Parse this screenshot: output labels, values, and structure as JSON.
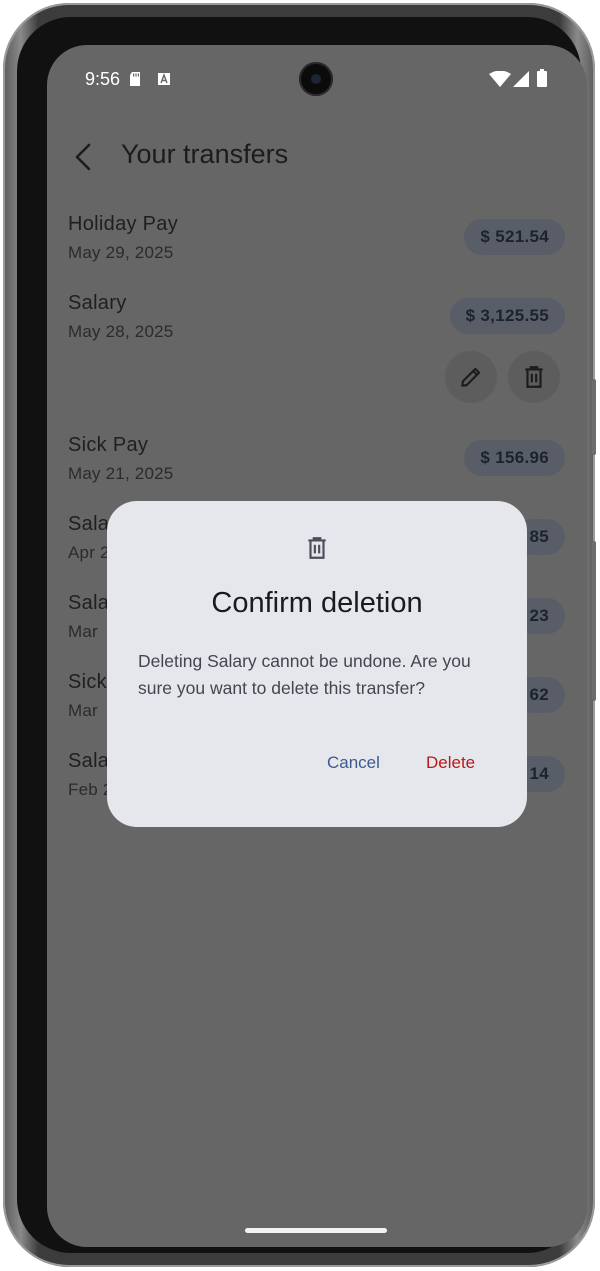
{
  "status_bar": {
    "time": "9:56"
  },
  "app_bar": {
    "title": "Your transfers",
    "back_icon": "arrow-back-icon"
  },
  "transfers": [
    {
      "name": "Holiday Pay",
      "date": "May 29, 2025",
      "amount": "$ 521.54"
    },
    {
      "name": "Salary",
      "date": "May 28, 2025",
      "amount": "$ 3,125.55"
    },
    {
      "name": "Sick Pay",
      "date": "May 21, 2025",
      "amount": "$ 156.96"
    },
    {
      "name": "Sala",
      "date": "Apr 2",
      "amount": "85"
    },
    {
      "name": "Sala",
      "date": "Mar",
      "amount": "23"
    },
    {
      "name": "Sick",
      "date": "Mar",
      "amount": "62"
    },
    {
      "name": "Sala",
      "date": "Feb 2",
      "amount": "14"
    }
  ],
  "item_actions": {
    "edit_icon": "pencil-icon",
    "delete_icon": "trash-icon"
  },
  "dialog": {
    "icon": "trash-icon",
    "title": "Confirm deletion",
    "message": "Deleting Salary cannot be undone. Are you sure you want to delete this transfer?",
    "cancel_label": "Cancel",
    "delete_label": "Delete"
  },
  "colors": {
    "scrim": "#666666",
    "dialog_bg": "#e6e7ec",
    "cancel": "#3b5b8f",
    "delete": "#ba1a1a"
  }
}
